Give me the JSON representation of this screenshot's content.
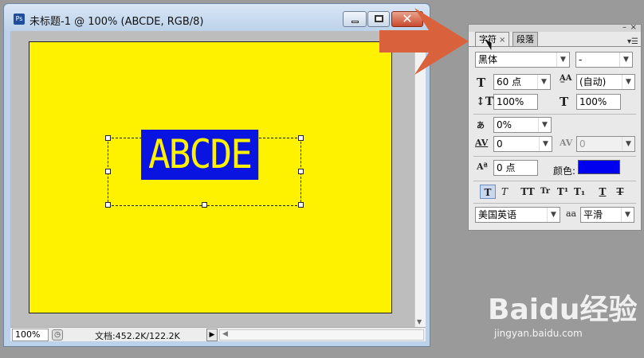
{
  "document_window": {
    "title": "未标题-1 @ 100% (ABCDE, RGB/8)",
    "app_icon": "Ps",
    "canvas_text": "ABCDE",
    "canvas_color": "#fff200",
    "text_highlight_color": "#0a14e0",
    "status": {
      "zoom": "100%",
      "doc_info": "文档:452.2K/122.2K"
    }
  },
  "character_panel": {
    "tabs": [
      {
        "label": "字符",
        "active": true
      },
      {
        "label": "段落",
        "active": false
      }
    ],
    "font_family": "黑体",
    "font_style": "-",
    "font_size": "60 点",
    "leading": "(自动)",
    "vertical_scale": "100%",
    "horizontal_scale": "100%",
    "tsume": "0%",
    "kerning": "0",
    "tracking": "0",
    "baseline_shift": "0 点",
    "color_label": "颜色:",
    "color_value": "#0000f0",
    "style_buttons": [
      "T",
      "T",
      "TT",
      "Tr",
      "T¹",
      "T₁",
      "T",
      "T"
    ],
    "language": "美国英语",
    "aa_label": "aa",
    "antialias": "平滑"
  },
  "watermark": {
    "logo": "Baidu经验",
    "url": "jingyan.baidu.com"
  }
}
